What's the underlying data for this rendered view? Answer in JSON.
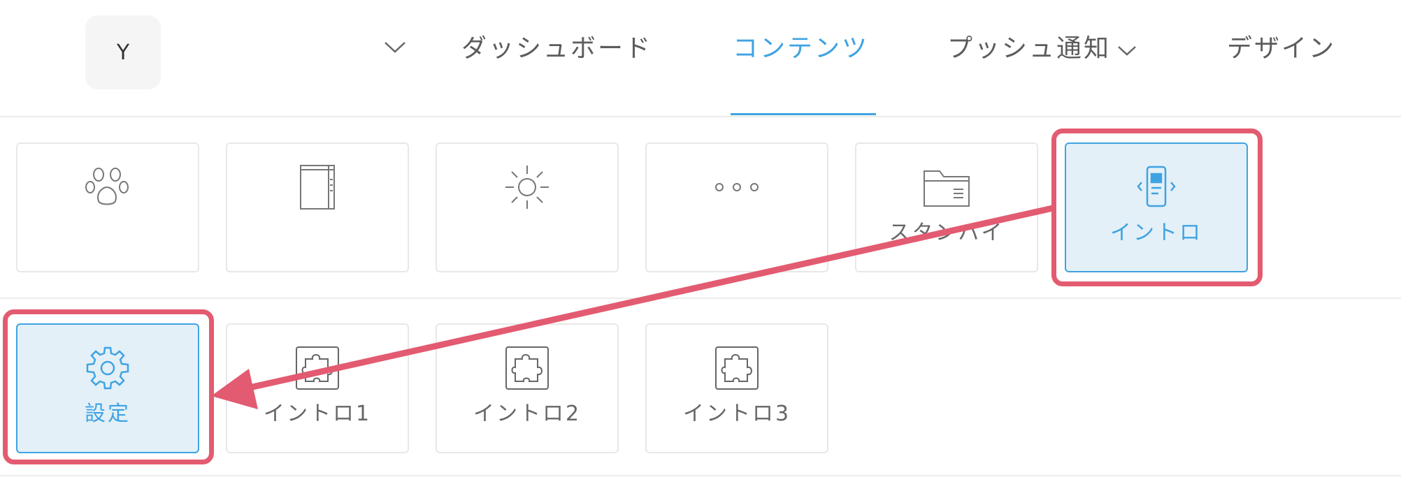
{
  "header": {
    "avatar_initial": "Y",
    "nav": {
      "dashboard": "ダッシュボード",
      "contents": "コンテンツ",
      "push": "プッシュ通知",
      "design": "デザイン"
    }
  },
  "tiles_row1": [
    {
      "icon": "paw-icon",
      "label": ""
    },
    {
      "icon": "notebook-icon",
      "label": ""
    },
    {
      "icon": "sun-icon",
      "label": ""
    },
    {
      "icon": "more-dots-icon",
      "label": ""
    },
    {
      "icon": "folder-icon",
      "label": "スタンバイ"
    },
    {
      "icon": "phone-intro-icon",
      "label": "イントロ"
    }
  ],
  "tiles_row2": [
    {
      "icon": "gear-icon",
      "label": "設定"
    },
    {
      "icon": "puzzle-icon",
      "label": "イントロ1"
    },
    {
      "icon": "puzzle-icon",
      "label": "イントロ2"
    },
    {
      "icon": "puzzle-icon",
      "label": "イントロ3"
    }
  ],
  "colors": {
    "accent": "#3fa3e2",
    "highlight": "#e35b70",
    "selected_bg": "#e3f0f8",
    "border": "#e8e8e8"
  }
}
